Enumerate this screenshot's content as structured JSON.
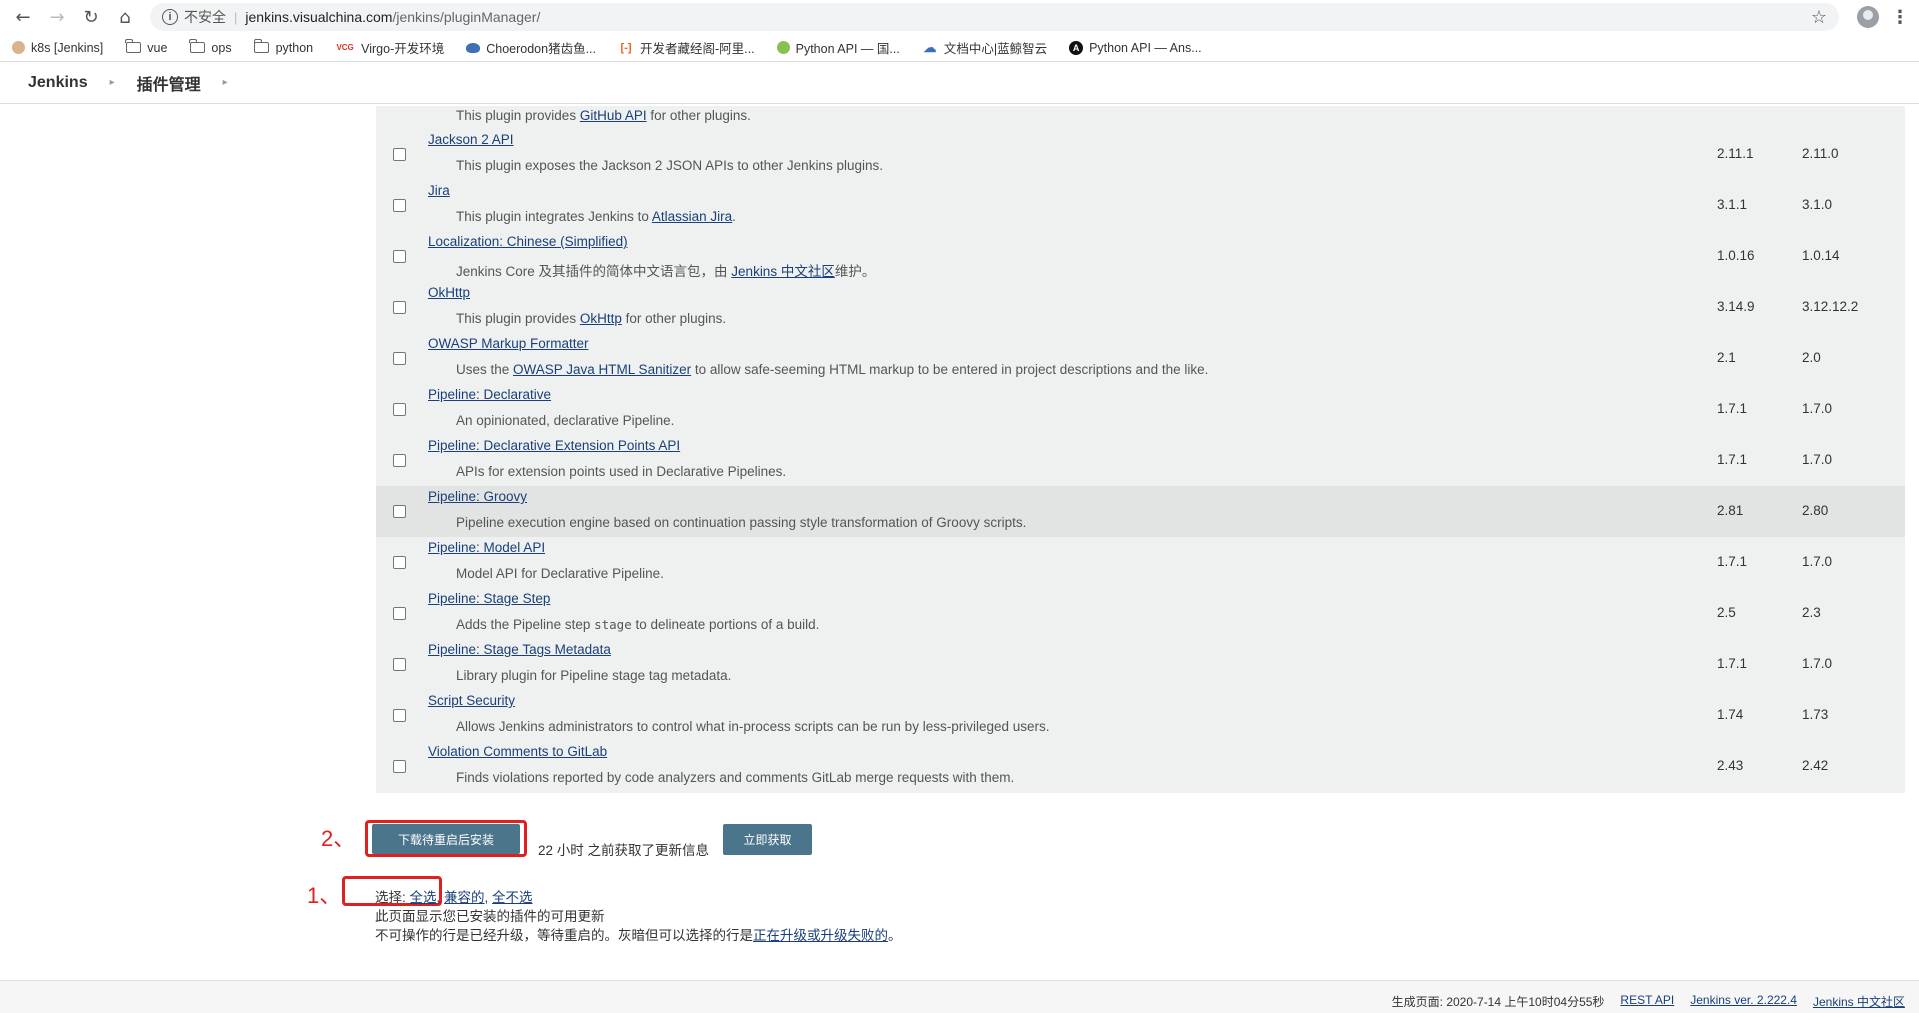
{
  "browser": {
    "insecure_label": "不安全",
    "url_domain": "jenkins.visualchina.com",
    "url_path": "/jenkins/pluginManager/",
    "bookmarks": [
      {
        "label": "k8s [Jenkins]",
        "icon": "jenkins-icon"
      },
      {
        "label": "vue",
        "icon": "folder-icon"
      },
      {
        "label": "ops",
        "icon": "folder-icon"
      },
      {
        "label": "python",
        "icon": "folder-icon"
      },
      {
        "label": "Virgo-开发环境",
        "icon": "vcg-icon",
        "icon_text": "VCG"
      },
      {
        "label": "Choerodon猪齿鱼...",
        "icon": "choerodon-icon"
      },
      {
        "label": "开发者藏经阁-阿里...",
        "icon": "aliyun-icon",
        "icon_text": "[-]"
      },
      {
        "label": "Python API — 国...",
        "icon": "python-icon"
      },
      {
        "label": "文档中心|蓝鲸智云",
        "icon": "cloud-icon"
      },
      {
        "label": "Python API — Ans...",
        "icon": "ansible-icon",
        "icon_text": "A"
      }
    ]
  },
  "header": {
    "crumb_jenkins": "Jenkins",
    "crumb_plugins": "插件管理"
  },
  "table": {
    "top_desc_prefix": "This plugin provides ",
    "top_desc_link": "GitHub API",
    "top_desc_suffix": " for other plugins.",
    "rows": [
      {
        "name": "Jackson 2 API",
        "desc": "This plugin exposes the Jackson 2 JSON APIs to other Jenkins plugins.",
        "new": "2.11.1",
        "installed": "2.11.0"
      },
      {
        "name": "Jira",
        "desc_prefix": "This plugin integrates Jenkins to ",
        "desc_link": "Atlassian Jira",
        "desc_suffix": ".",
        "new": "3.1.1",
        "installed": "3.1.0"
      },
      {
        "name": "Localization: Chinese (Simplified)",
        "desc_prefix": "Jenkins Core 及其插件的简体中文语言包，由 ",
        "desc_link": "Jenkins 中文社区",
        "desc_suffix": "维护。",
        "new": "1.0.16",
        "installed": "1.0.14"
      },
      {
        "name": "OkHttp",
        "desc_prefix": "This plugin provides ",
        "desc_link": "OkHttp",
        "desc_suffix": " for other plugins.",
        "new": "3.14.9",
        "installed": "3.12.12.2"
      },
      {
        "name": "OWASP Markup Formatter",
        "desc_prefix": "Uses the ",
        "desc_link": "OWASP Java HTML Sanitizer",
        "desc_suffix": " to allow safe-seeming HTML markup to be entered in project descriptions and the like.",
        "new": "2.1",
        "installed": "2.0"
      },
      {
        "name": "Pipeline: Declarative",
        "desc": "An opinionated, declarative Pipeline.",
        "new": "1.7.1",
        "installed": "1.7.0"
      },
      {
        "name": "Pipeline: Declarative Extension Points API",
        "desc": "APIs for extension points used in Declarative Pipelines.",
        "new": "1.7.1",
        "installed": "1.7.0"
      },
      {
        "name": "Pipeline: Groovy",
        "desc": "Pipeline execution engine based on continuation passing style transformation of Groovy scripts.",
        "new": "2.81",
        "installed": "2.80"
      },
      {
        "name": "Pipeline: Model API",
        "desc": "Model API for Declarative Pipeline.",
        "new": "1.7.1",
        "installed": "1.7.0"
      },
      {
        "name": "Pipeline: Stage Step",
        "desc_prefix": "Adds the Pipeline step ",
        "desc_code": "stage",
        "desc_suffix": " to delineate portions of a build.",
        "new": "2.5",
        "installed": "2.3"
      },
      {
        "name": "Pipeline: Stage Tags Metadata",
        "desc": "Library plugin for Pipeline stage tag metadata.",
        "new": "1.7.1",
        "installed": "1.7.0"
      },
      {
        "name": "Script Security",
        "desc": "Allows Jenkins administrators to control what in-process scripts can be run by less-privileged users.",
        "new": "1.74",
        "installed": "1.73"
      },
      {
        "name": "Violation Comments to GitLab",
        "desc": "Finds violations reported by code analyzers and comments GitLab merge requests with them.",
        "new": "2.43",
        "installed": "2.42"
      }
    ]
  },
  "actions": {
    "install_button": "下载待重启后安装",
    "update_info": "22 小时 之前获取了更新信息",
    "fetch_button": "立即获取",
    "select_label": "选择: ",
    "select_all": "全选",
    "select_compatible": "兼容的",
    "select_none": "全不选",
    "note1": "此页面显示您已安装的插件的可用更新",
    "note2_prefix": "不可操作的行是已经升级，等待重启的。灰暗但可以选择的行是",
    "note2_link": "正在升级或升级失败的",
    "note2_suffix": "。",
    "annotation_1": "1、",
    "annotation_2": "2、"
  },
  "footer": {
    "generated": "生成页面: 2020-7-14 上午10时04分55秒",
    "rest_api": "REST API",
    "version": "Jenkins ver. 2.222.4",
    "community": "Jenkins 中文社区"
  },
  "colors": {
    "button": "#4b758b",
    "annotation_red": "#e02020",
    "link": "#1a3f7a"
  }
}
